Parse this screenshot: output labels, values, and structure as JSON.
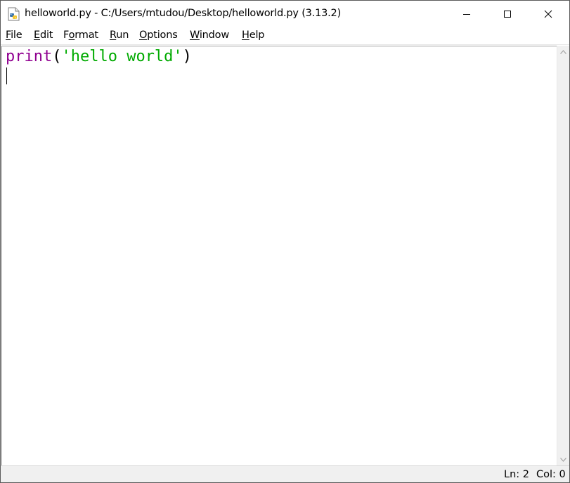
{
  "window": {
    "title": "helloworld.py - C:/Users/mtudou/Desktop/helloworld.py (3.13.2)",
    "icon": "python-file-icon"
  },
  "menu": {
    "file": {
      "mn": "F",
      "rest": "ile"
    },
    "edit": {
      "mn": "E",
      "rest": "dit"
    },
    "format": {
      "pre": "F",
      "mn": "o",
      "rest": "rmat"
    },
    "run": {
      "mn": "R",
      "rest": "un"
    },
    "options": {
      "mn": "O",
      "rest": "ptions"
    },
    "window": {
      "mn": "W",
      "rest": "indow"
    },
    "help": {
      "mn": "H",
      "rest": "elp"
    }
  },
  "editor": {
    "lines": [
      {
        "builtin": "print",
        "open": "(",
        "string": "'hello world'",
        "close": ")"
      }
    ]
  },
  "status": {
    "line": "Ln: 2",
    "col": "Col: 0"
  },
  "colors": {
    "builtin": "#900090",
    "string": "#00aa00",
    "status_bg": "#f0f0f0"
  }
}
